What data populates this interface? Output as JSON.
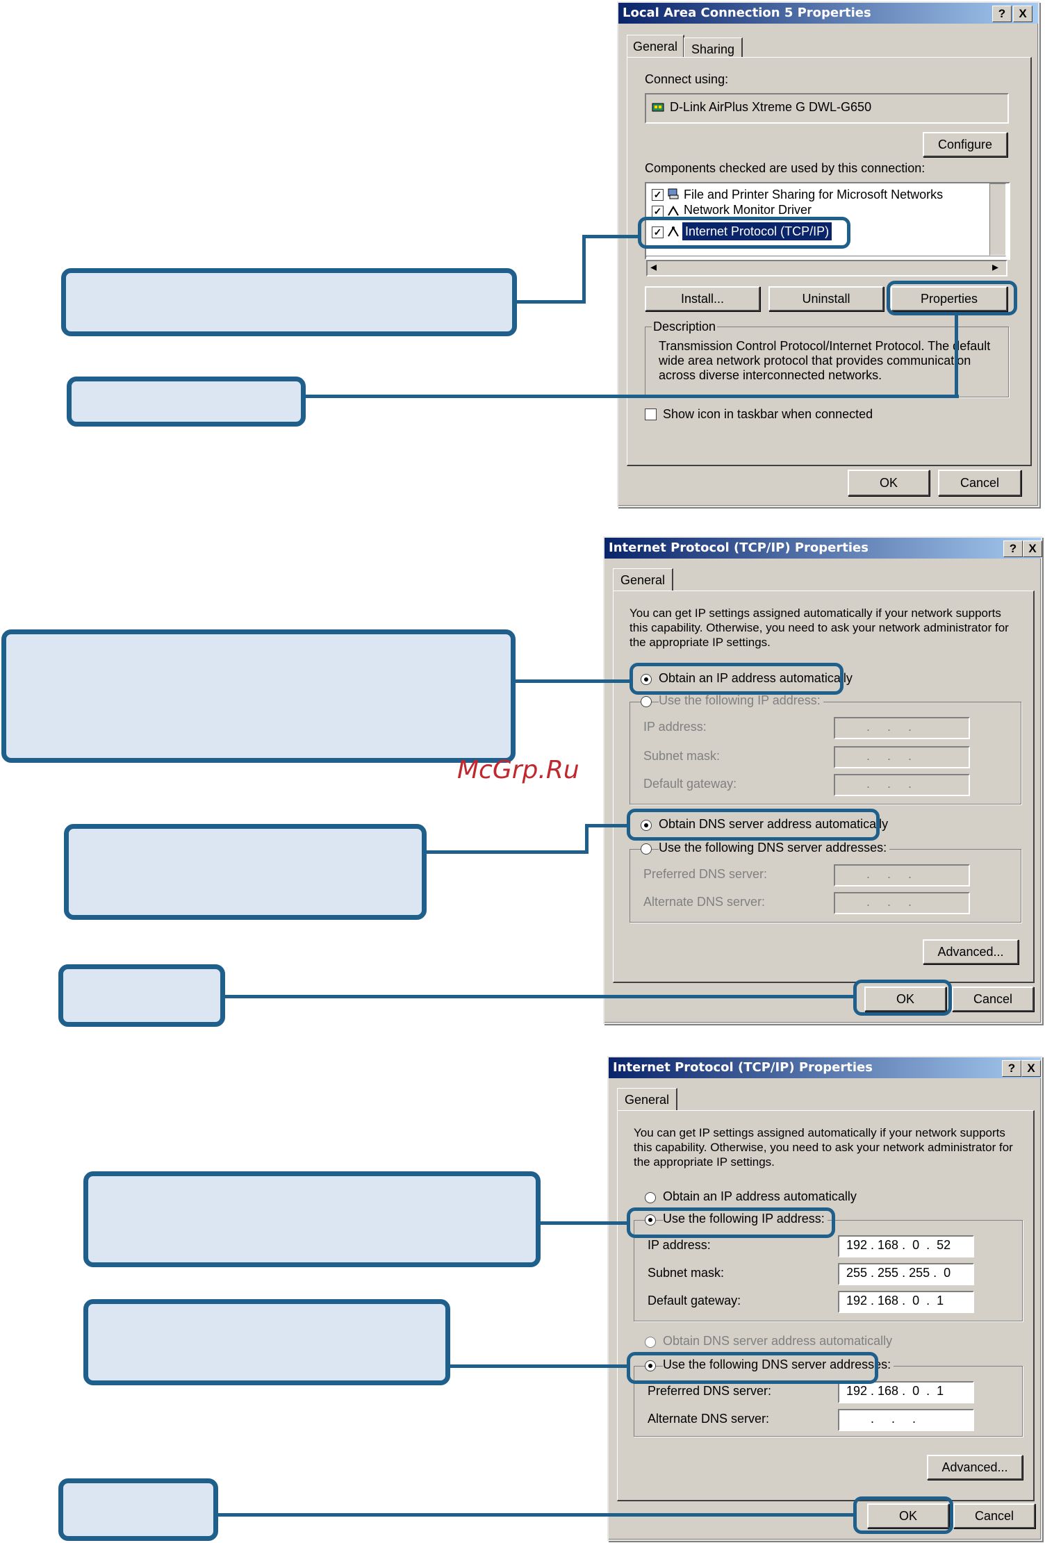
{
  "dialog1": {
    "title": "Local Area Connection 5 Properties",
    "help_btn": "?",
    "close_btn": "X",
    "tabs": [
      "General",
      "Sharing"
    ],
    "connect_using_label": "Connect using:",
    "adapter_name": "D-Link AirPlus Xtreme G DWL-G650",
    "configure_label": "Configure",
    "components_label": "Components checked are used by this connection:",
    "components": [
      "File and Printer Sharing for Microsoft Networks",
      "Network Monitor Driver",
      "Internet Protocol (TCP/IP)"
    ],
    "install_label": "Install...",
    "uninstall_label": "Uninstall",
    "properties_label": "Properties",
    "description_label": "Description",
    "description_text": "Transmission Control Protocol/Internet Protocol. The default wide area network protocol that provides communication across diverse interconnected networks.",
    "show_icon_label": "Show icon in taskbar when connected",
    "ok_label": "OK",
    "cancel_label": "Cancel"
  },
  "dialog2": {
    "title": "Internet Protocol (TCP/IP) Properties",
    "help_btn": "?",
    "close_btn": "X",
    "tab": "General",
    "intro": "You can get IP settings assigned automatically if your network supports this capability. Otherwise, you need to ask your network administrator for the appropriate IP settings.",
    "obtain_ip_auto": "Obtain an IP address automatically",
    "use_following_ip": "Use the following IP address:",
    "ip_address_label": "IP address:",
    "subnet_label": "Subnet mask:",
    "gateway_label": "Default gateway:",
    "obtain_dns_auto": "Obtain DNS server address automatically",
    "use_following_dns": "Use the following DNS server addresses:",
    "preferred_dns_label": "Preferred DNS server:",
    "alternate_dns_label": "Alternate DNS server:",
    "empty_ip": " .     .     . ",
    "advanced_label": "Advanced...",
    "ok_label": "OK",
    "cancel_label": "Cancel"
  },
  "dialog3": {
    "title": "Internet Protocol (TCP/IP) Properties",
    "help_btn": "?",
    "close_btn": "X",
    "tab": "General",
    "intro": "You can get IP settings assigned automatically if your network supports this capability. Otherwise, you need to ask your network administrator for the appropriate IP settings.",
    "obtain_ip_auto": "Obtain an IP address automatically",
    "use_following_ip": "Use the following IP address:",
    "ip_address_label": "IP address:",
    "ip_address_value": "192 . 168 .  0  .  52",
    "subnet_label": "Subnet mask:",
    "subnet_value": "255 . 255 . 255 .  0",
    "gateway_label": "Default gateway:",
    "gateway_value": "192 . 168 .  0  .  1",
    "obtain_dns_auto": "Obtain DNS server address automatically",
    "use_following_dns": "Use the following DNS server addresses:",
    "preferred_dns_label": "Preferred DNS server:",
    "preferred_dns_value": "192 . 168 .  0  .  1",
    "alternate_dns_label": "Alternate DNS server:",
    "empty_ip": " .     .     . ",
    "advanced_label": "Advanced...",
    "ok_label": "OK",
    "cancel_label": "Cancel"
  },
  "watermark": "McGrp.Ru",
  "colors": {
    "callout_border": "#1f5f8b",
    "callout_fill": "#dce6f2",
    "dialog_bg": "#d4d0c8",
    "title_bar": "#0a246a"
  }
}
